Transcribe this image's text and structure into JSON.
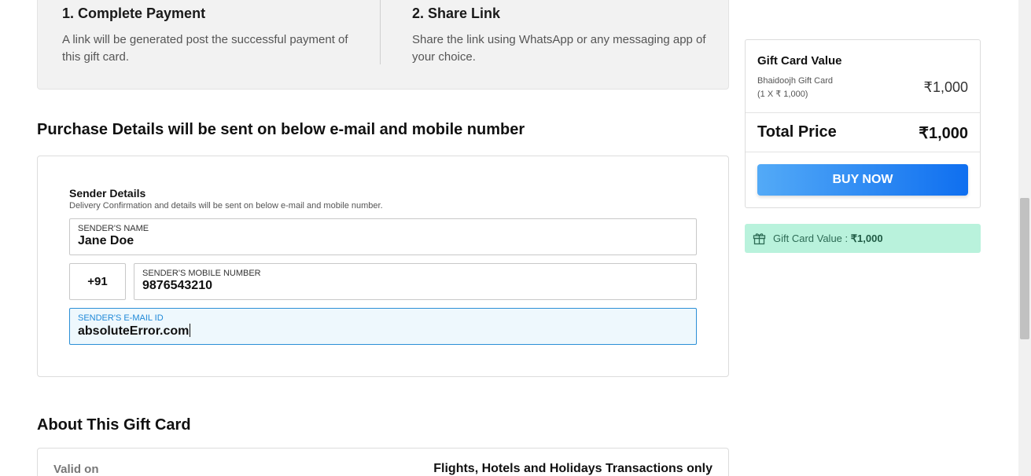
{
  "steps": [
    {
      "title": "1. Complete Payment",
      "desc": "A link will be generated post the successful payment of this gift card."
    },
    {
      "title": "2. Share Link",
      "desc": "Share the link using WhatsApp or any messaging app of your choice."
    }
  ],
  "purchase": {
    "title": "Purchase Details will be sent on below e-mail and mobile number"
  },
  "sender": {
    "heading": "Sender Details",
    "subheading": "Delivery Confirmation and details will be sent on below e-mail and mobile number.",
    "name_label": "SENDER'S NAME",
    "name_value": "Jane Doe",
    "country_code": "+91",
    "mobile_label": "SENDER'S MOBILE NUMBER",
    "mobile_value": "9876543210",
    "email_label": "SENDER'S E-MAIL ID",
    "email_value": "absoluteError.com"
  },
  "about": {
    "title": "About This Gift Card",
    "valid_label": "Valid on",
    "valid_value": "Flights, Hotels and Holidays Transactions only"
  },
  "summary": {
    "gift_card_value_title": "Gift Card Value",
    "item_name": "Bhaidoojh Gift Card",
    "item_qty": "(1 X ₹ 1,000)",
    "item_price": "₹1,000",
    "total_label": "Total Price",
    "total_value": "₹1,000",
    "buy_label": "BUY NOW",
    "buy_gradient": [
      "#53aaf7",
      "#0f6ff0"
    ]
  },
  "banner": {
    "label": "Gift Card Value : ",
    "value": "₹1,000",
    "icon": "gift-icon",
    "bg_color": "#b9f2dc"
  }
}
